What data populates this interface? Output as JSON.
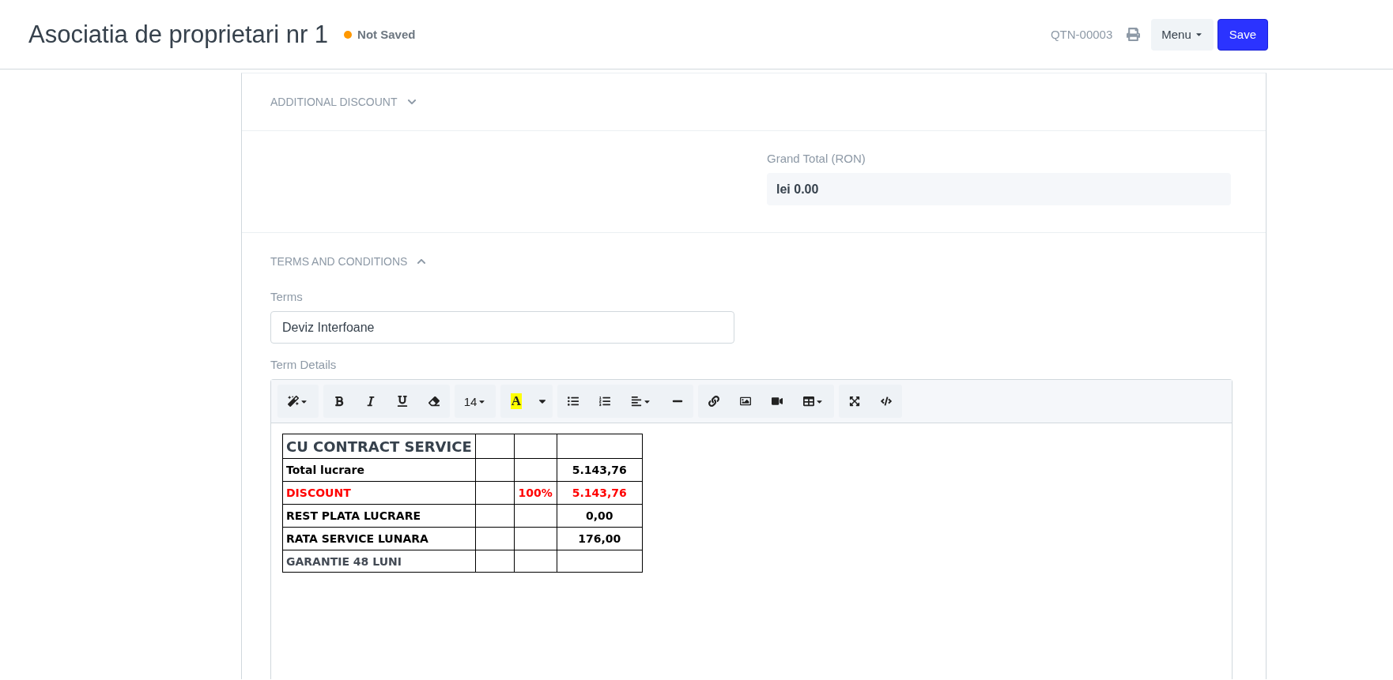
{
  "header": {
    "title": "Asociatia de proprietari nr 1",
    "status": {
      "label": "Not Saved",
      "color": "#ff9800"
    },
    "doc_id": "QTN-00003",
    "menu_button": "Menu",
    "save_button": "Save"
  },
  "sections": [
    {
      "kind": "collapsible",
      "title": "ADDITIONAL DISCOUNT",
      "expanded": false
    },
    {
      "kind": "total",
      "label": "Grand Total (RON)",
      "value": "lei 0.00"
    },
    {
      "kind": "collapsible",
      "title": "TERMS AND CONDITIONS",
      "expanded": true
    }
  ],
  "terms": {
    "label": "Terms",
    "value": "Deviz Interfoane"
  },
  "term_details": {
    "label": "Term Details",
    "toolbar": {
      "font_size": "14",
      "font_color_label": "A"
    },
    "table": {
      "rows": [
        {
          "kind": "title",
          "column_1": "CU CONTRACT SERVICE"
        },
        {
          "kind": "bold",
          "column_1": "Total lucrare",
          "column_4": "5.143,76"
        },
        {
          "kind": "discount",
          "column_1": "DISCOUNT",
          "column_3": "100%",
          "column_4": "5.143,76"
        },
        {
          "kind": "bold",
          "column_1": "REST PLATA LUCRARE",
          "column_4": "0,00"
        },
        {
          "kind": "bold",
          "column_1": "RATA SERVICE LUNARA",
          "column_4": "176,00"
        },
        {
          "kind": "muted",
          "column_1": "GARANTIE 48 LUNI"
        }
      ]
    }
  }
}
